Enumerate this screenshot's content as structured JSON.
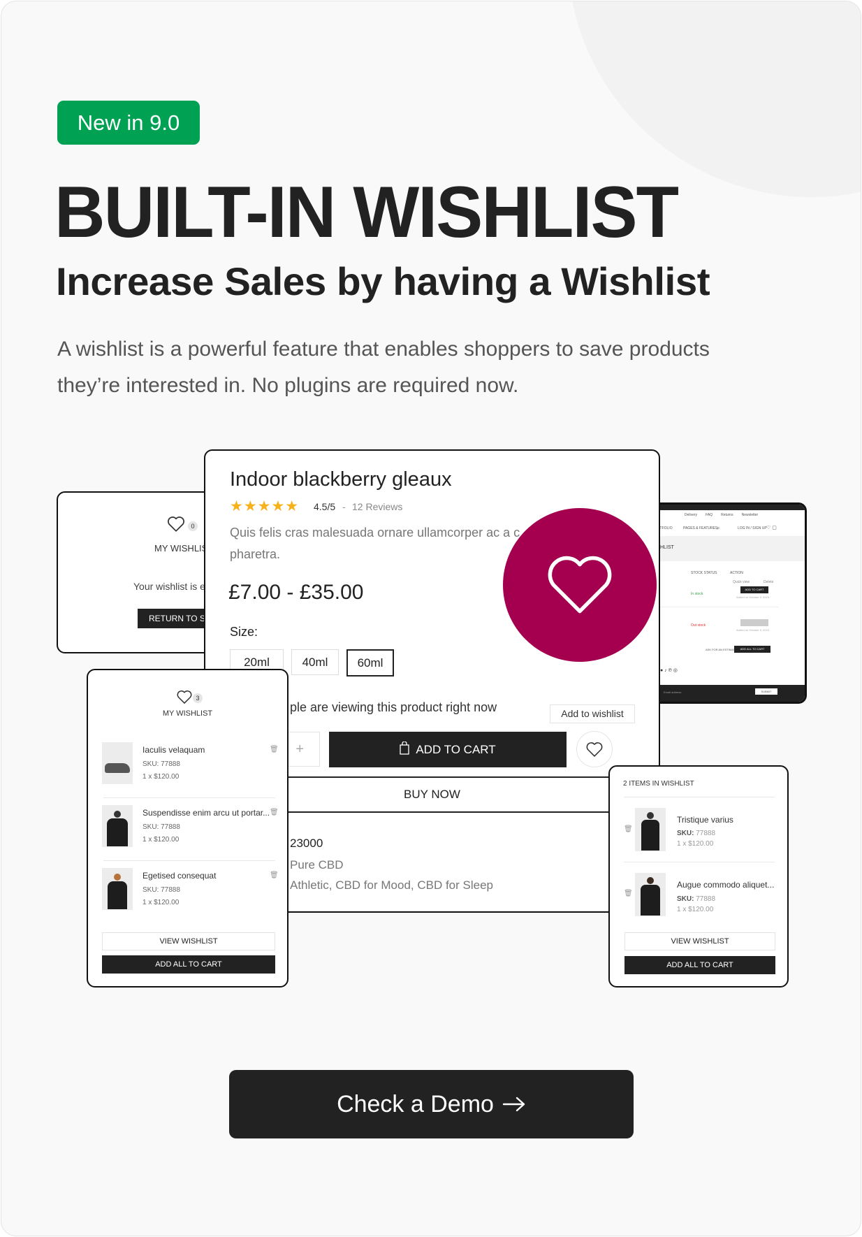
{
  "badge": "New in 9.0",
  "title": "BUILT-IN WISHLIST",
  "subtitle": "Increase Sales by having a Wishlist",
  "description": "A wishlist is a powerful feature that enables shoppers to save products they’re interested in. No plugins are required now.",
  "colors": {
    "badge": "#00a153",
    "accent": "#a4004f",
    "dark": "#222222",
    "in_stock": "#3aa04a",
    "out_stock": "#d33"
  },
  "empty_wishlist": {
    "count": "0",
    "label": "MY WISHLIS",
    "message": "Your wishlist is e",
    "button": "RETURN TO SH"
  },
  "product": {
    "title": "Indoor blackberry gleaux",
    "stars": 5,
    "rating": "4.5/5",
    "separator": "-",
    "reviews": "12 Reviews",
    "desc_line1": "Quis felis cras malesuada ornare ullamcorper ac a c",
    "desc_line2": "pharetra.",
    "price": "£7.00 - £35.00",
    "size_label": "Size:",
    "sizes": [
      "20ml",
      "40ml",
      "60ml"
    ],
    "selected_size": "60ml",
    "viewing": "ple are viewing this product right now",
    "tooltip": "Add to wishlist",
    "qty_plus": "+",
    "add_to_cart": "ADD TO CART",
    "buy_now": "BUY NOW",
    "meta": [
      "23000",
      "Pure CBD",
      "Athletic, CBD for Mood, CBD for Sleep"
    ]
  },
  "browser": {
    "topbar": [
      "Delivery",
      "FAQ",
      "Returns",
      "Newsletter"
    ],
    "nav": [
      "RTFOLIO",
      "PAGES & FEATURES",
      "LOG IN / SIGN UP"
    ],
    "page_title": "HLIST",
    "headers": [
      "STOCK STATUS",
      "ACTION"
    ],
    "rows": [
      {
        "status": "In stock",
        "quick": "Quick view",
        "delete": "Delete",
        "button": "ADD TO CART",
        "date": "Added on October 5, 2023"
      },
      {
        "status": "Out stock",
        "button": "",
        "date": "Added on October 5, 2023"
      }
    ],
    "ask": "ASK FOR AN ESTIMATE",
    "add_all": "ADD ALL TO CART",
    "email": "Email address",
    "submit": "SUBMIT"
  },
  "wishlist_left": {
    "count": "3",
    "title": "MY WISHLIST",
    "items": [
      {
        "name": "Iaculis velaquam",
        "sku": "SKU: 77888",
        "price": "1 x $120.00"
      },
      {
        "name": "Suspendisse enim arcu ut portar...",
        "sku": "SKU: 77888",
        "price": "1 x $120.00"
      },
      {
        "name": "Egetised consequat",
        "sku": "SKU: 77888",
        "price": "1 x $120.00"
      }
    ],
    "view": "VIEW WISHLIST",
    "add_all": "ADD ALL TO CART"
  },
  "wishlist_right": {
    "title": "2 ITEMS IN WISHLIST",
    "items": [
      {
        "name": "Tristique varius",
        "sku_label": "SKU:",
        "sku": "77888",
        "price": "1 x $120.00"
      },
      {
        "name": "Augue commodo aliquet...",
        "sku_label": "SKU:",
        "sku": "77888",
        "price": "1 x $120.00"
      }
    ],
    "view": "VIEW WISHLIST",
    "add_all": "ADD ALL TO CART"
  },
  "cta": {
    "label": "Check a Demo",
    "icon": "arrow-right-icon"
  }
}
